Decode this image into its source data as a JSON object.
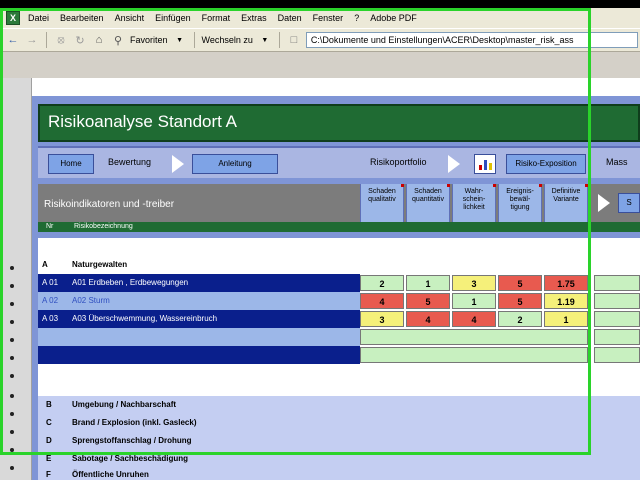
{
  "menubar": {
    "items": [
      "Datei",
      "Bearbeiten",
      "Ansicht",
      "Einfügen",
      "Format",
      "Extras",
      "Daten",
      "Fenster",
      "?",
      "Adobe PDF"
    ]
  },
  "toolbar": {
    "favorites_label": "Favoriten",
    "switch_label": "Wechseln zu",
    "address": "C:\\Dokumente und Einstellungen\\ACER\\Desktop\\master_risk_ass"
  },
  "sheet": {
    "title": "Risikoanalyse Standort A"
  },
  "nav": {
    "home_label": "Home",
    "bewertung_label": "Bewertung",
    "anleitung_label": "Anleitung",
    "portfolio_label": "Risikoportfolio",
    "exposition_label": "Risiko-Exposition",
    "mass_label": "Mass",
    "s_label": "S"
  },
  "header": {
    "title": "Risikoindikatoren und -treiber",
    "columns": [
      [
        "Schaden",
        "qualitativ"
      ],
      [
        "Schaden",
        "quantitativ"
      ],
      [
        "Wahr-",
        "schein-",
        "lichkeit"
      ],
      [
        "Ereignis-",
        "bewäl-",
        "tigung"
      ],
      [
        "Definitive",
        "Variante"
      ]
    ],
    "nr_label": "Nr",
    "desc_label": "Risikobezeichnung"
  },
  "rows": [
    {
      "code": "A",
      "name": "Naturgewalten",
      "values": []
    },
    {
      "code": "A 01",
      "name": "A01 Erdbeben , Erdbewegungen",
      "values": [
        "2",
        "1",
        "3",
        "5",
        "1.75"
      ]
    },
    {
      "code": "A 02",
      "name": "A02 Sturm",
      "values": [
        "4",
        "5",
        "1",
        "5",
        "1.19"
      ]
    },
    {
      "code": "A 03",
      "name": "A03 Überschwemmung, Wassereinbruch",
      "values": [
        "3",
        "4",
        "4",
        "2",
        "1"
      ]
    }
  ],
  "categories": [
    {
      "code": "B",
      "name": "Umgebung / Nachbarschaft"
    },
    {
      "code": "C",
      "name": "Brand / Explosion (inkl. Gasleck)"
    },
    {
      "code": "D",
      "name": "Sprengstoffanschlag / Drohung"
    },
    {
      "code": "E",
      "name": "Sabotage / Sachbeschädigung"
    },
    {
      "code": "F",
      "name": "Öffentliche Unruhen"
    }
  ],
  "colors": {
    "title_band": "#1f6b33",
    "yellow": "#f5f07a",
    "red": "#e85a4f",
    "light_green": "#c8f0c0",
    "navy": "#0a1f8c",
    "frame_green": "#2ad32a"
  }
}
